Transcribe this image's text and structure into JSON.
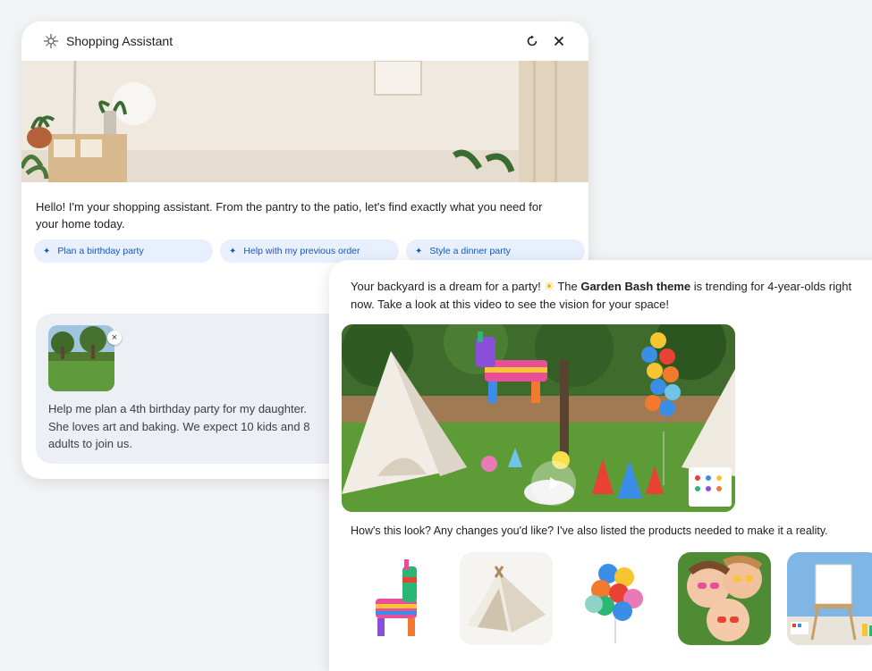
{
  "assistant_window": {
    "title": "Shopping Assistant",
    "icons": {
      "app": "sparkle-logo-icon",
      "refresh": "refresh-icon",
      "close": "close-icon"
    },
    "greeting": "Hello! I'm your shopping assistant. From the pantry to the patio, let's find exactly what you need for your home today.",
    "suggestions": [
      {
        "label": "Plan a birthday party"
      },
      {
        "label": "Help with my previous order"
      },
      {
        "label": "Style a dinner party"
      }
    ],
    "user_message": {
      "text": "Help me plan a 4th birthday party for my daughter. She loves art and baking. We expect 10 kids and 8 adults to join us.",
      "attachment_close": "×"
    }
  },
  "response_window": {
    "reply_pre": "Your backyard is a dream for a party! ",
    "reply_emoji": "☀",
    "reply_the": " The ",
    "reply_bold": "Garden Bash theme",
    "reply_post": " is trending for 4-year-olds right now. Take a look at this video to see the vision for your space!",
    "followup": "How's this look? Any changes you'd like? I've also listed the products needed to make it a reality.",
    "products": [
      {
        "icon": "llama-pinata-image"
      },
      {
        "icon": "play-tent-image"
      },
      {
        "icon": "balloon-bunch-image"
      },
      {
        "icon": "kids-sunglasses-image"
      },
      {
        "icon": "art-easel-image"
      }
    ]
  },
  "colors": {
    "chip_bg": "#e8f0fe",
    "chip_text": "#1a56b5",
    "bubble_bg": "#eceff3"
  }
}
